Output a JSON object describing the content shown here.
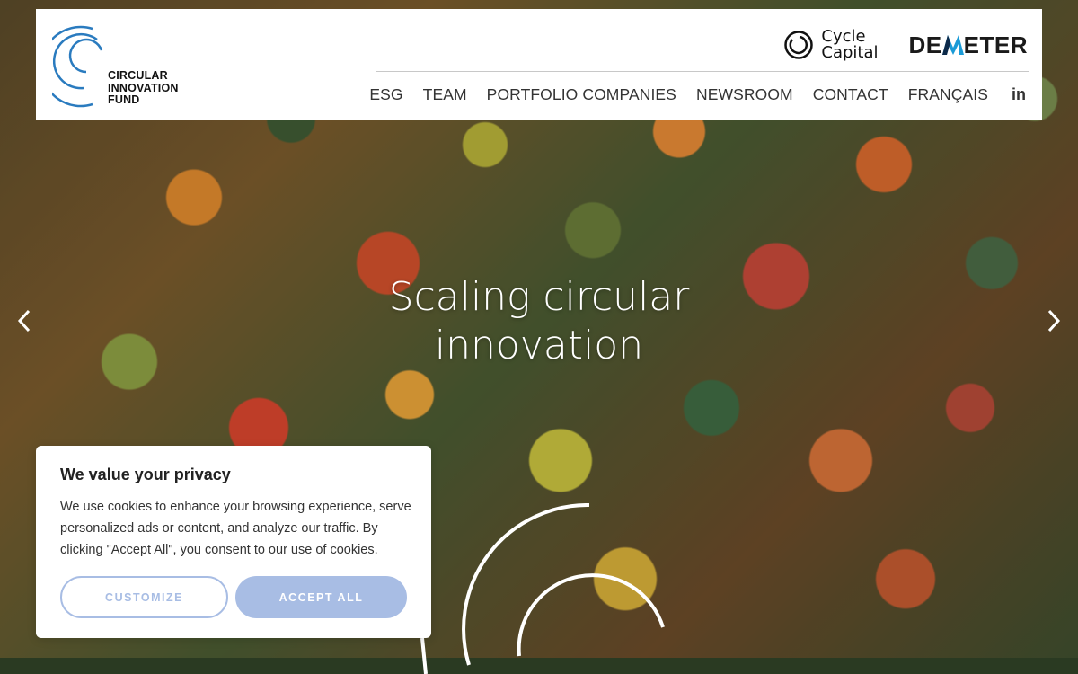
{
  "brand": {
    "logo_lines": [
      "CIRCULAR",
      "INNOVATION",
      "FUND"
    ],
    "logo_color": "#2a7bbf"
  },
  "partners": {
    "cycle_line1": "Cycle",
    "cycle_line2": "Capital",
    "demeter_pre": "DE",
    "demeter_post": "ETER"
  },
  "nav": {
    "items": [
      "ESG",
      "TEAM",
      "PORTFOLIO COMPANIES",
      "NEWSROOM",
      "CONTACT",
      "FRANÇAIS"
    ],
    "linkedin": "in"
  },
  "hero": {
    "headline_line1": "Scaling circular",
    "headline_line2": "innovation",
    "prev_icon": "chevron-left-icon",
    "next_icon": "chevron-right-icon"
  },
  "cookie": {
    "title": "We value your privacy",
    "body": "We use cookies to enhance your browsing experience, serve personalized ads or content, and analyze our traffic. By clicking \"Accept All\", you consent to our use of cookies.",
    "customize_label": "CUSTOMIZE",
    "accept_label": "ACCEPT ALL",
    "accent_color": "#a8bde4"
  }
}
